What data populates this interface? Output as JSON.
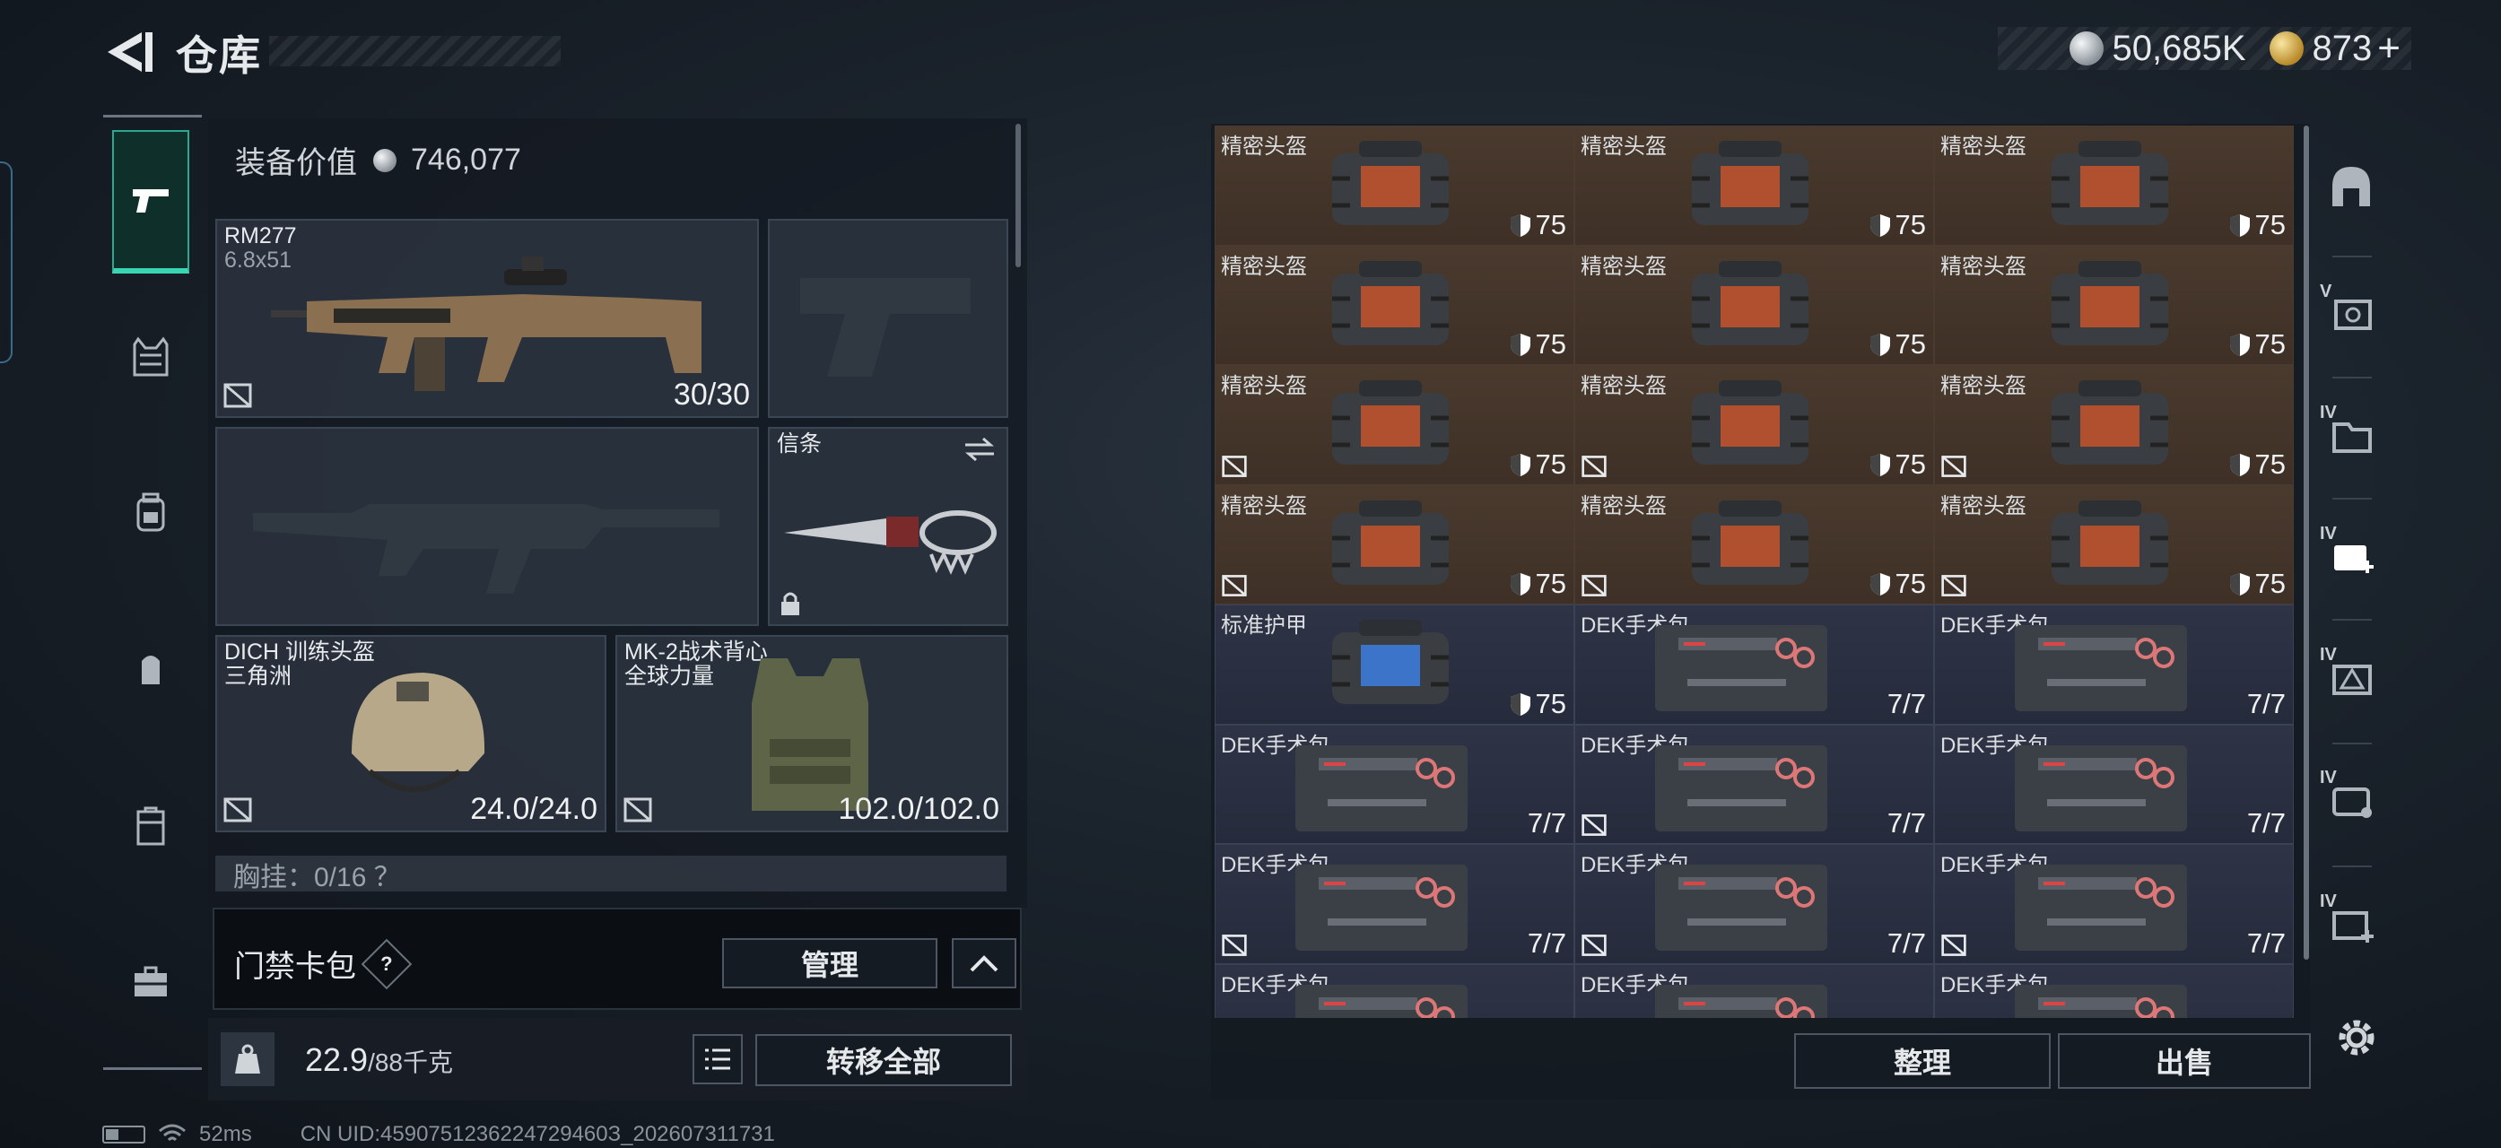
{
  "header": {
    "title": "仓库",
    "currency_silver": "50,685K",
    "currency_gold": "873",
    "currency_gold_plus": "+"
  },
  "loadout": {
    "equipment_value_label": "装备价值",
    "equipment_value": "746,077",
    "primary_weapon": {
      "name": "RM277",
      "caliber": "6.8x51",
      "ammo": "30/30"
    },
    "melee": {
      "name": "信条"
    },
    "helmet": {
      "name": "DICH 训练头盔",
      "map": "三角洲",
      "durability": "24.0/24.0"
    },
    "armor": {
      "name": "MK-2战术背心",
      "map": "全球力量",
      "durability": "102.0/102.0"
    },
    "chest_rig": {
      "label": "胸挂：0/16 ？"
    }
  },
  "keycase": {
    "label": "门禁卡包",
    "help": "?",
    "manage_label": "管理"
  },
  "weight": {
    "current": "22.9",
    "capacity": "/88千克",
    "transfer_label": "转移全部"
  },
  "storage": {
    "items": [
      {
        "name": "精密头盔",
        "value": "75",
        "kind": "bag",
        "flag": false
      },
      {
        "name": "精密头盔",
        "value": "75",
        "kind": "bag",
        "flag": false
      },
      {
        "name": "精密头盔",
        "value": "75",
        "kind": "bag",
        "flag": false
      },
      {
        "name": "精密头盔",
        "value": "75",
        "kind": "bag",
        "flag": false
      },
      {
        "name": "精密头盔",
        "value": "75",
        "kind": "bag",
        "flag": false
      },
      {
        "name": "精密头盔",
        "value": "75",
        "kind": "bag",
        "flag": false
      },
      {
        "name": "精密头盔",
        "value": "75",
        "kind": "bag",
        "flag": true
      },
      {
        "name": "精密头盔",
        "value": "75",
        "kind": "bag",
        "flag": true
      },
      {
        "name": "精密头盔",
        "value": "75",
        "kind": "bag",
        "flag": true
      },
      {
        "name": "精密头盔",
        "value": "75",
        "kind": "bag",
        "flag": true
      },
      {
        "name": "精密头盔",
        "value": "75",
        "kind": "bag",
        "flag": true
      },
      {
        "name": "精密头盔",
        "value": "75",
        "kind": "bag",
        "flag": true
      },
      {
        "name": "标准护甲",
        "value": "75",
        "kind": "bag-blue",
        "flag": false
      },
      {
        "name": "DEK手术包",
        "value": "7/7",
        "kind": "kit",
        "flag": false
      },
      {
        "name": "DEK手术包",
        "value": "7/7",
        "kind": "kit",
        "flag": false
      },
      {
        "name": "DEK手术包",
        "value": "7/7",
        "kind": "kit",
        "flag": false
      },
      {
        "name": "DEK手术包",
        "value": "7/7",
        "kind": "kit",
        "flag": true
      },
      {
        "name": "DEK手术包",
        "value": "7/7",
        "kind": "kit",
        "flag": false
      },
      {
        "name": "DEK手术包",
        "value": "7/7",
        "kind": "kit",
        "flag": true
      },
      {
        "name": "DEK手术包",
        "value": "7/7",
        "kind": "kit",
        "flag": true
      },
      {
        "name": "DEK手术包",
        "value": "7/7",
        "kind": "kit",
        "flag": true
      },
      {
        "name": "DEK手术包",
        "value": "",
        "kind": "kit",
        "flag": false
      },
      {
        "name": "DEK手术包",
        "value": "",
        "kind": "kit",
        "flag": false
      },
      {
        "name": "DEK手术包",
        "value": "",
        "kind": "kit",
        "flag": false
      }
    ],
    "sort_label": "整理",
    "sell_label": "出售"
  },
  "right_tabs": [
    {
      "icon": "armor-helmet-icon",
      "label": ""
    },
    {
      "icon": "safe-box-icon",
      "label": "V"
    },
    {
      "icon": "folder-box-icon",
      "label": "IV"
    },
    {
      "icon": "medkit-plus-icon",
      "label": "IV"
    },
    {
      "icon": "warning-box-icon",
      "label": "IV"
    },
    {
      "icon": "bag-tag-icon",
      "label": "IV"
    },
    {
      "icon": "box-plus-icon",
      "label": "IV"
    }
  ],
  "status_bar": {
    "ping": "52ms",
    "uid": "CN UID:4590751236224729460З_202607311731"
  }
}
